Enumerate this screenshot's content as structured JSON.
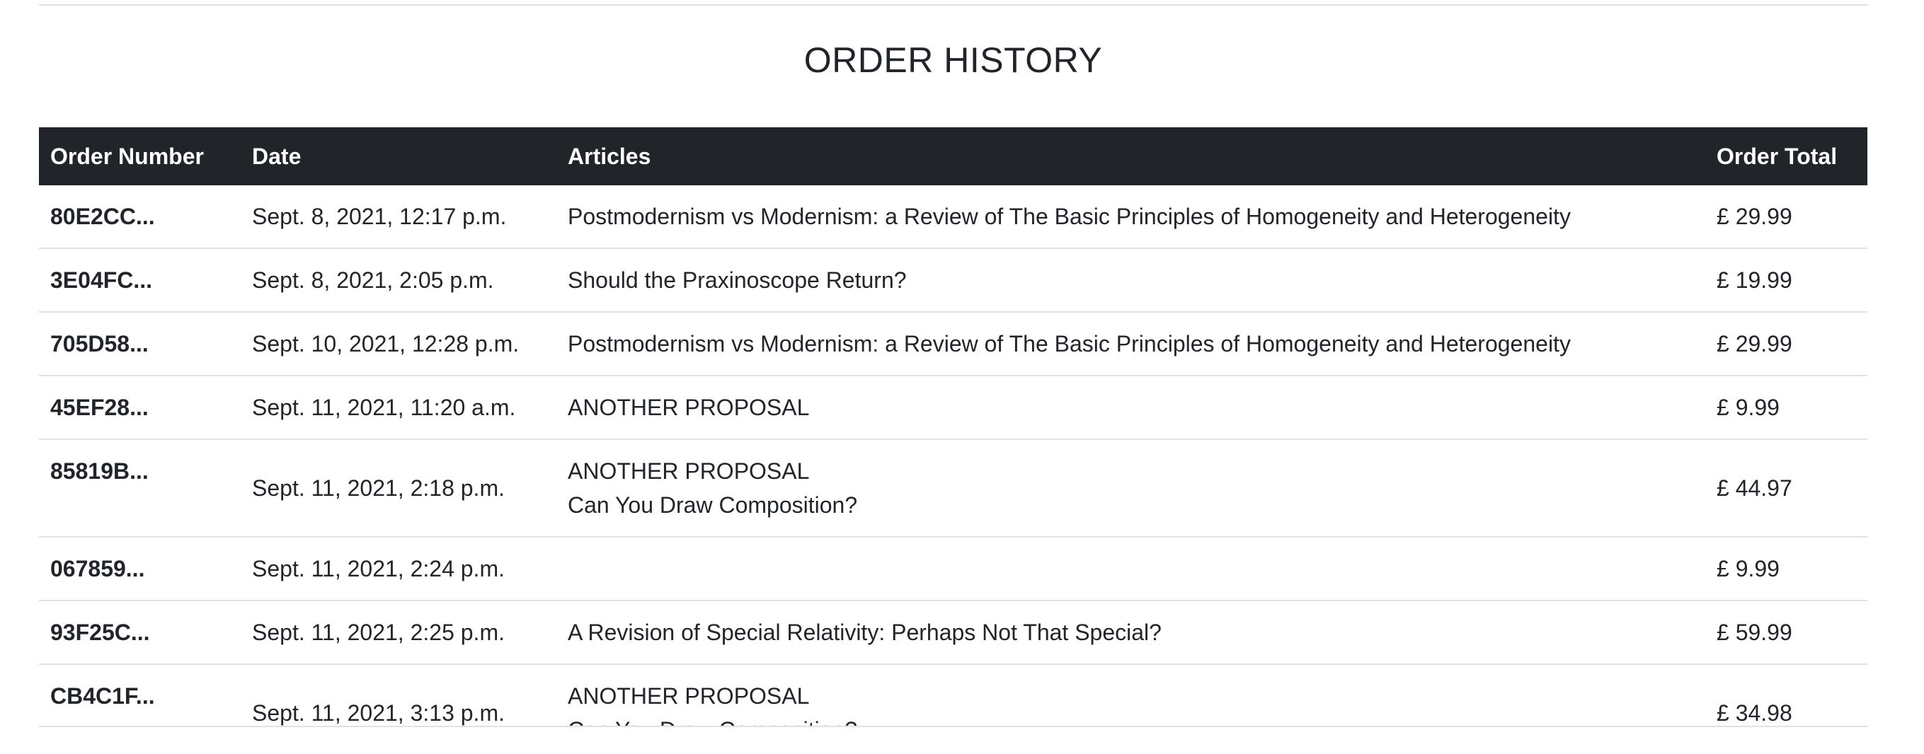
{
  "page": {
    "title": "ORDER HISTORY"
  },
  "table": {
    "headers": {
      "order_number": "Order Number",
      "date": "Date",
      "articles": "Articles",
      "order_total": "Order Total"
    },
    "rows": [
      {
        "number": "80E2CC...",
        "date": "Sept. 8, 2021, 12:17 p.m.",
        "articles": [
          "Postmodernism vs Modernism: a Review of The Basic Principles of Homogeneity and Heterogeneity"
        ],
        "total": "£ 29.99"
      },
      {
        "number": "3E04FC...",
        "date": "Sept. 8, 2021, 2:05 p.m.",
        "articles": [
          "Should the Praxinoscope Return?"
        ],
        "total": "£ 19.99"
      },
      {
        "number": "705D58...",
        "date": "Sept. 10, 2021, 12:28 p.m.",
        "articles": [
          "Postmodernism vs Modernism: a Review of The Basic Principles of Homogeneity and Heterogeneity"
        ],
        "total": "£ 29.99"
      },
      {
        "number": "45EF28...",
        "date": "Sept. 11, 2021, 11:20 a.m.",
        "articles": [
          "ANOTHER PROPOSAL"
        ],
        "total": "£ 9.99"
      },
      {
        "number": "85819B...",
        "date": "Sept. 11, 2021, 2:18 p.m.",
        "articles": [
          "ANOTHER PROPOSAL",
          "Can You Draw Composition?"
        ],
        "total": "£ 44.97"
      },
      {
        "number": "067859...",
        "date": "Sept. 11, 2021, 2:24 p.m.",
        "articles": [],
        "total": "£ 9.99"
      },
      {
        "number": "93F25C...",
        "date": "Sept. 11, 2021, 2:25 p.m.",
        "articles": [
          "A Revision of Special Relativity: Perhaps Not That Special?"
        ],
        "total": "£ 59.99"
      },
      {
        "number": "CB4C1F...",
        "date": "Sept. 11, 2021, 3:13 p.m.",
        "articles": [
          "ANOTHER PROPOSAL",
          "Can You Draw Composition?"
        ],
        "total": "£ 34.98"
      }
    ]
  }
}
